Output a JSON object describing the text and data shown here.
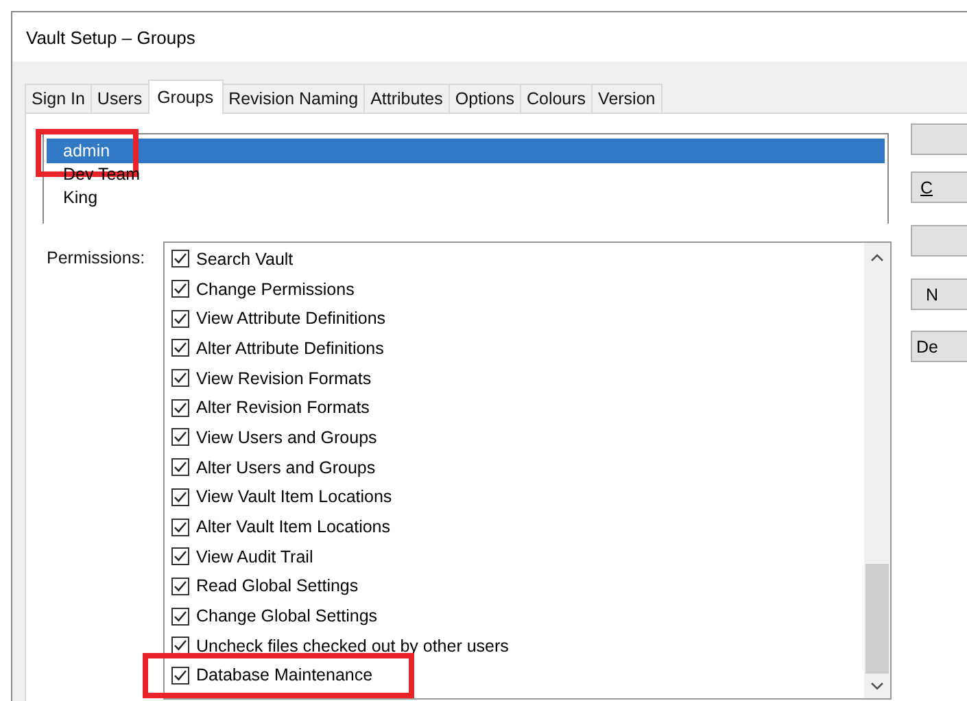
{
  "window": {
    "title": "Vault Setup – Groups"
  },
  "tabs": [
    {
      "label": "Sign In",
      "selected": false
    },
    {
      "label": "Users",
      "selected": false
    },
    {
      "label": "Groups",
      "selected": true
    },
    {
      "label": "Revision Naming",
      "selected": false
    },
    {
      "label": "Attributes",
      "selected": false
    },
    {
      "label": "Options",
      "selected": false
    },
    {
      "label": "Colours",
      "selected": false
    },
    {
      "label": "Version",
      "selected": false
    }
  ],
  "groups": [
    {
      "name": "admin",
      "selected": true,
      "highlighted": true
    },
    {
      "name": "Dev Team",
      "selected": false,
      "highlighted": false
    },
    {
      "name": "King",
      "selected": false,
      "highlighted": false
    }
  ],
  "permissions": {
    "label": "Permissions:",
    "items": [
      {
        "label": "Search Vault",
        "checked": true,
        "highlighted": false
      },
      {
        "label": "Change Permissions",
        "checked": true,
        "highlighted": false
      },
      {
        "label": "View Attribute Definitions",
        "checked": true,
        "highlighted": false
      },
      {
        "label": "Alter Attribute Definitions",
        "checked": true,
        "highlighted": false
      },
      {
        "label": "View Revision Formats",
        "checked": true,
        "highlighted": false
      },
      {
        "label": "Alter Revision Formats",
        "checked": true,
        "highlighted": false
      },
      {
        "label": "View Users and Groups",
        "checked": true,
        "highlighted": false
      },
      {
        "label": "Alter Users and Groups",
        "checked": true,
        "highlighted": false
      },
      {
        "label": "View Vault Item Locations",
        "checked": true,
        "highlighted": false
      },
      {
        "label": "Alter Vault Item Locations",
        "checked": true,
        "highlighted": false
      },
      {
        "label": "View Audit Trail",
        "checked": true,
        "highlighted": false
      },
      {
        "label": "Read Global Settings",
        "checked": true,
        "highlighted": false
      },
      {
        "label": "Change Global Settings",
        "checked": true,
        "highlighted": false
      },
      {
        "label": "Uncheck files checked out by other users",
        "checked": true,
        "highlighted": false
      },
      {
        "label": "Database Maintenance",
        "checked": true,
        "highlighted": true
      }
    ]
  },
  "buttons": [
    {
      "kind": "blank"
    },
    {
      "kind": "text",
      "label": "C"
    },
    {
      "kind": "blank"
    },
    {
      "kind": "text",
      "label": "N"
    },
    {
      "kind": "text",
      "label": "De"
    }
  ]
}
